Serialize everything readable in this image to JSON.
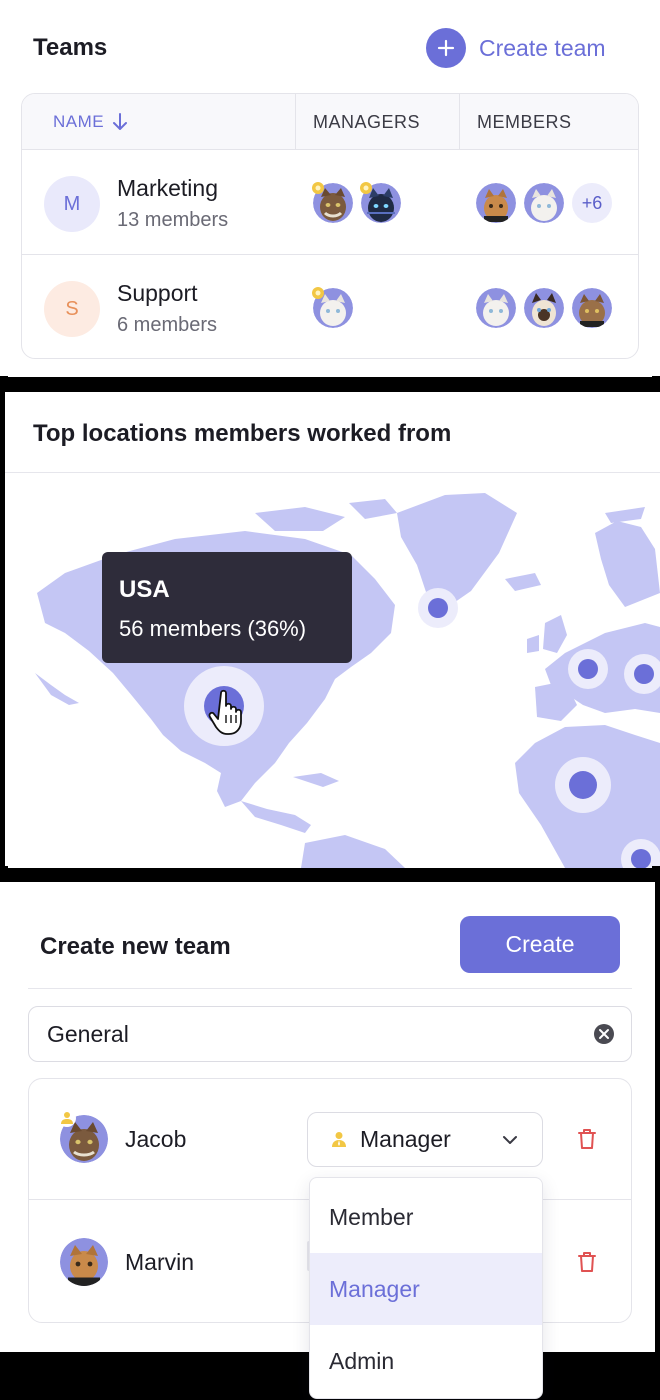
{
  "teams": {
    "title": "Teams",
    "create_label": "Create team",
    "columns": {
      "name": "NAME",
      "managers": "MANAGERS",
      "members": "MEMBERS"
    },
    "rows": [
      {
        "initial": "M",
        "name": "Marketing",
        "members_text": "13 members",
        "extra_members": "+6",
        "avatar_bg": "#e9e9fb",
        "avatar_fg": "#6b6fd8"
      },
      {
        "initial": "S",
        "name": "Support",
        "members_text": "6 members",
        "avatar_bg": "#fdebe2",
        "avatar_fg": "#e8905a"
      }
    ]
  },
  "map": {
    "title": "Top locations members worked from",
    "tooltip": {
      "country": "USA",
      "detail": "56 members (36%)"
    }
  },
  "create_team": {
    "title": "Create new team",
    "create_button": "Create",
    "team_name_value": "General",
    "members": [
      {
        "name": "Jacob",
        "role": "Manager"
      },
      {
        "name": "Marvin"
      }
    ],
    "role_options": [
      "Member",
      "Manager",
      "Admin"
    ],
    "selected_option": "Manager"
  },
  "colors": {
    "accent": "#6b6fd8",
    "map_land": "#c4c6f4",
    "tooltip_bg": "#2e2c3a",
    "danger": "#e05252",
    "crown": "#f2c744"
  }
}
